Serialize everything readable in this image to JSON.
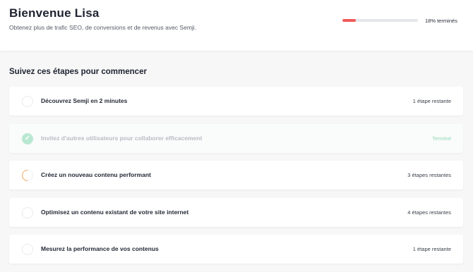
{
  "header": {
    "title": "Bienvenue Lisa",
    "subtitle": "Obtenez plus de trafic SEO, de conversions et de revenus avec Semji.",
    "progress_percent": 18,
    "progress_label": "18% terminés",
    "progress_color": "#f05a5a"
  },
  "section": {
    "title": "Suivez ces étapes pour commencer"
  },
  "steps": [
    {
      "label": "Découvrez Semji en 2 minutes",
      "status": "1 étape restante",
      "state": "todo"
    },
    {
      "label": "Invitez d'autres utilisateurs pour collaborer efficacement",
      "status": "Terminé",
      "state": "done"
    },
    {
      "label": "Créez un nouveau contenu performant",
      "status": "3 étapes restantes",
      "state": "in-progress"
    },
    {
      "label": "Optimisez un contenu existant de votre site internet",
      "status": "4 étapes restantes",
      "state": "todo"
    },
    {
      "label": "Mesurez la performance de vos contenus",
      "status": "1 étape restante",
      "state": "todo"
    }
  ]
}
